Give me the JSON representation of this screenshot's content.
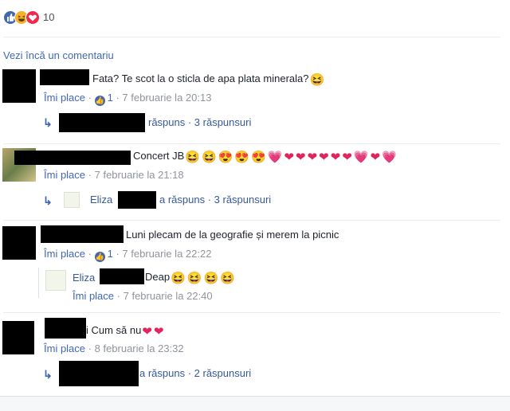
{
  "reactions": {
    "count": "10",
    "icons": [
      "like-icon",
      "haha-icon",
      "love-icon"
    ]
  },
  "more_comments": "Vezi încă un comentariu",
  "comments": [
    {
      "text": "Fata? Te scot la o sticla de apa plata minerala?",
      "emojis": [
        "😆"
      ],
      "like": "Îmi place",
      "reactions_count": "1",
      "time": "7 februarie la 20:13",
      "reply_summary": "răspuns · 3 răspunsuri"
    },
    {
      "text": "Concert JB",
      "emojis": [
        "😆",
        "😆",
        "😍",
        "😍",
        "😍",
        "💗",
        "❤",
        "❤",
        "❤",
        "❤",
        "❤",
        "❤",
        "💗",
        "❤",
        "💗"
      ],
      "like": "Îmi place",
      "time": "7 februarie la 21:18",
      "reply_name": "Eliza",
      "reply_summary": "a răspuns · 3 răspunsuri"
    },
    {
      "text": "Luni plecam de la geografie și merem la picnic",
      "like": "Îmi place",
      "reactions_count": "1",
      "time": "7 februarie la 22:22",
      "reply": {
        "name": "Eliza",
        "text": "Deap",
        "emojis": [
          "😆",
          "😆",
          "😆",
          "😆"
        ],
        "like": "Îmi place",
        "time": "7 februarie la 22:40"
      }
    },
    {
      "text": "i Cum să nu",
      "emojis": [
        "❤",
        "❤"
      ],
      "like": "Îmi place",
      "time": "8 februarie la 23:32",
      "reply_summary": "a răspuns · 2 răspunsuri"
    }
  ],
  "colors": {
    "link": "#4267b2",
    "meta": "#90949c",
    "like_blue": "#4267b2",
    "love_red": "#f0284a",
    "haha_yellow": "#f7b125"
  }
}
